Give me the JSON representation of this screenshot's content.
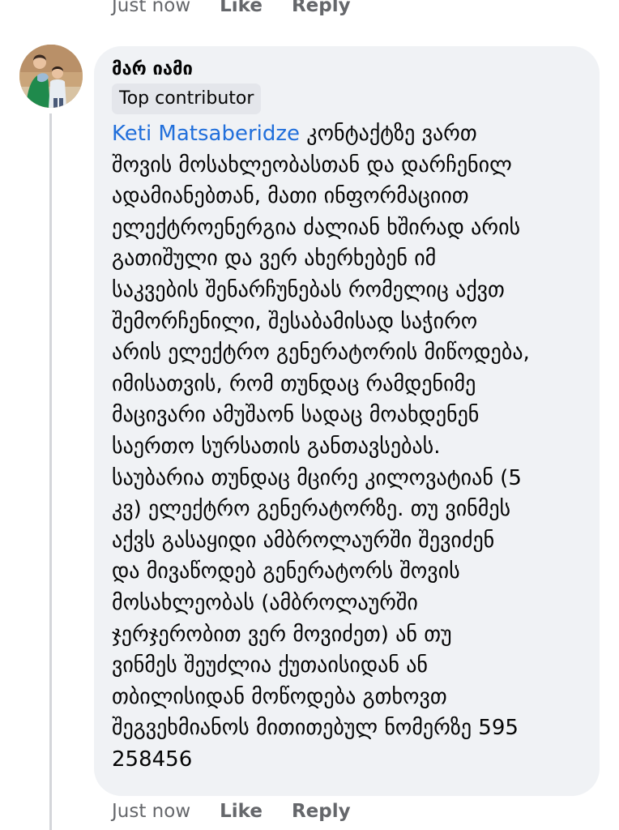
{
  "top_actions": {
    "time": "Just now",
    "like": "Like",
    "reply": "Reply"
  },
  "comment": {
    "author": "მარ იამი",
    "badge": "Top contributor",
    "avatar_icon": "profile-photo-icon",
    "mention": "Keti Matsaberidze",
    "first_line_rest": " კონტაქტზე ვართ",
    "lines": [
      "შოვის მოსახლეობასთან და დარჩენილ",
      "ადამიანებთან, მათი ინფორმაციით",
      "ელექტროენერგია ძალიან ხშირად არის",
      "გათიშული და ვერ ახერხებენ იმ",
      "საკვების შენარჩუნებას რომელიც აქვთ",
      "შემორჩენილი, შესაბამისად საჭირო",
      "არის ელექტრო გენერატორის მიწოდება,",
      "იმისათვის, რომ თუნდაც რამდენიმე",
      "მაცივარი ამუშაონ სადაც მოახდენენ",
      "საერთო სურსათის განთავსებას.",
      "საუბარია თუნდაც მცირე კილოვატიან (5",
      "კვ) ელექტრო გენერატორზე. თუ ვინმეს",
      "აქვს გასაყიდი ამბროლაურში შევიძენ",
      "და მივაწოდებ გენერატორს შოვის",
      "მოსახლეობას (ამბროლაურში",
      "ჯერჯერობით ვერ მოვიძეთ) ან თუ",
      "ვინმეს შეუძლია ქუთაისიდან ან",
      "თბილისიდან მოწოდება გთხოვთ",
      "შეგვეხმიანოს მითითებულ ნომერზე 595",
      "258456"
    ]
  },
  "bottom_actions": {
    "time": "Just now",
    "like": "Like",
    "reply": "Reply"
  },
  "colors": {
    "bubble": "#f0f2f5",
    "badge": "#e4e6eb",
    "mention": "#216fdb",
    "meta_text": "#65676b",
    "thread_line": "#d4d6da"
  }
}
